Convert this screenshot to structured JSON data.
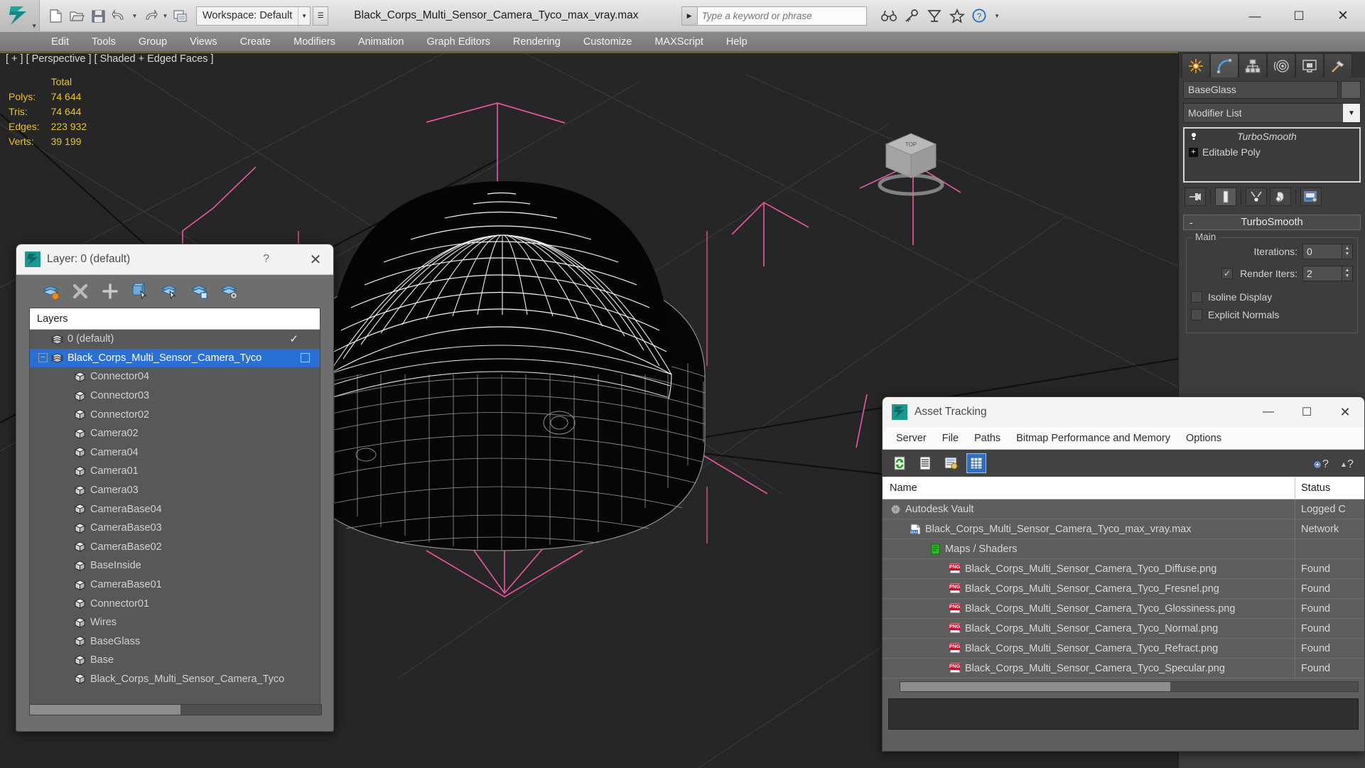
{
  "titlebar": {
    "workspace_label": "Workspace: Default",
    "file_title": "Black_Corps_Multi_Sensor_Camera_Tyco_max_vray.max",
    "search_placeholder": "Type a keyword or phrase",
    "quick_access": [
      {
        "name": "new-file-icon",
        "label": "New"
      },
      {
        "name": "open-file-icon",
        "label": "Open"
      },
      {
        "name": "save-file-icon",
        "label": "Save"
      },
      {
        "name": "undo-icon",
        "label": "Undo"
      },
      {
        "name": "redo-icon",
        "label": "Redo"
      },
      {
        "name": "project-folder-icon",
        "label": "Set Project Folder"
      }
    ],
    "help_icons": [
      {
        "name": "binoculars-icon",
        "label": "Search"
      },
      {
        "name": "key-icon",
        "label": "Keyboard Shortcuts"
      },
      {
        "name": "satellite-dish-icon",
        "label": "Communication Center"
      },
      {
        "name": "star-icon",
        "label": "Favorites"
      },
      {
        "name": "question-help-icon",
        "label": "Help"
      }
    ],
    "window_buttons": {
      "minimize": "—",
      "maximize": "☐",
      "close": "✕"
    }
  },
  "menubar": {
    "items": [
      "Edit",
      "Tools",
      "Group",
      "Views",
      "Create",
      "Modifiers",
      "Animation",
      "Graph Editors",
      "Rendering",
      "Customize",
      "MAXScript",
      "Help"
    ]
  },
  "viewport": {
    "label": "[ + ] [ Perspective ] [ Shaded + Edged Faces ]",
    "stats": {
      "column_header": "Total",
      "rows": [
        {
          "label": "Polys:",
          "value": "74 644"
        },
        {
          "label": "Tris:",
          "value": "74 644"
        },
        {
          "label": "Edges:",
          "value": "223 932"
        },
        {
          "label": "Verts:",
          "value": "39 199"
        }
      ]
    },
    "viewcube_label": "TOP"
  },
  "command_panel": {
    "tabs": [
      {
        "name": "create-tab",
        "label": "Create"
      },
      {
        "name": "modify-tab",
        "label": "Modify"
      },
      {
        "name": "hierarchy-tab",
        "label": "Hierarchy"
      },
      {
        "name": "motion-tab",
        "label": "Motion"
      },
      {
        "name": "display-tab",
        "label": "Display"
      },
      {
        "name": "utilities-tab",
        "label": "Utilities"
      }
    ],
    "active_tab_index": 1,
    "object_name": "BaseGlass",
    "modifier_list_label": "Modifier List",
    "modifier_stack": [
      {
        "label": "TurboSmooth",
        "italic": true
      },
      {
        "label": "Editable Poly",
        "italic": false
      }
    ],
    "stack_tools": [
      {
        "name": "pin-stack-icon"
      },
      {
        "name": "show-end-result-icon"
      },
      {
        "name": "make-unique-icon"
      },
      {
        "name": "remove-modifier-icon"
      },
      {
        "name": "configure-modifier-sets-icon"
      }
    ],
    "rollout": {
      "title": "TurboSmooth",
      "collapse_glyph": "-",
      "group_label": "Main",
      "iterations_label": "Iterations:",
      "iterations_value": "0",
      "render_iters_label": "Render Iters:",
      "render_iters_value": "2",
      "render_iters_checked": true,
      "isoline_label": "Isoline Display",
      "isoline_checked": false,
      "explicit_normals_label": "Explicit Normals",
      "explicit_normals_checked": false
    }
  },
  "layer_dialog": {
    "title": "Layer: 0 (default)",
    "help_glyph": "?",
    "close_glyph": "✕",
    "toolbar": [
      {
        "name": "new-layer-icon"
      },
      {
        "name": "delete-layer-icon"
      },
      {
        "name": "add-layer-icon"
      },
      {
        "name": "select-objects-in-layer-icon"
      },
      {
        "name": "select-highlighted-layer-icon"
      },
      {
        "name": "add-selection-to-layer-icon"
      },
      {
        "name": "layer-settings-icon"
      }
    ],
    "column_header": "Layers",
    "rows": [
      {
        "label": "0 (default)",
        "type": "layer",
        "indent": 0,
        "selected": false,
        "expander": null,
        "checked": true
      },
      {
        "label": "Black_Corps_Multi_Sensor_Camera_Tyco",
        "type": "layer",
        "indent": 0,
        "selected": true,
        "expander": "−",
        "checked": false,
        "box": true
      },
      {
        "label": "Connector04",
        "type": "object",
        "indent": 1,
        "selected": false
      },
      {
        "label": "Connector03",
        "type": "object",
        "indent": 1,
        "selected": false
      },
      {
        "label": "Connector02",
        "type": "object",
        "indent": 1,
        "selected": false
      },
      {
        "label": "Camera02",
        "type": "object",
        "indent": 1,
        "selected": false
      },
      {
        "label": "Camera04",
        "type": "object",
        "indent": 1,
        "selected": false
      },
      {
        "label": "Camera01",
        "type": "object",
        "indent": 1,
        "selected": false
      },
      {
        "label": "Camera03",
        "type": "object",
        "indent": 1,
        "selected": false
      },
      {
        "label": "CameraBase04",
        "type": "object",
        "indent": 1,
        "selected": false
      },
      {
        "label": "CameraBase03",
        "type": "object",
        "indent": 1,
        "selected": false
      },
      {
        "label": "CameraBase02",
        "type": "object",
        "indent": 1,
        "selected": false
      },
      {
        "label": "BaseInside",
        "type": "object",
        "indent": 1,
        "selected": false
      },
      {
        "label": "CameraBase01",
        "type": "object",
        "indent": 1,
        "selected": false
      },
      {
        "label": "Connector01",
        "type": "object",
        "indent": 1,
        "selected": false
      },
      {
        "label": "Wires",
        "type": "object",
        "indent": 1,
        "selected": false
      },
      {
        "label": "BaseGlass",
        "type": "object",
        "indent": 1,
        "selected": false
      },
      {
        "label": "Base",
        "type": "object",
        "indent": 1,
        "selected": false
      },
      {
        "label": "Black_Corps_Multi_Sensor_Camera_Tyco",
        "type": "object",
        "indent": 1,
        "selected": false
      }
    ]
  },
  "asset_tracking": {
    "title": "Asset Tracking",
    "window_buttons": {
      "minimize": "—",
      "maximize": "☐",
      "close": "✕"
    },
    "menu": [
      "Server",
      "File",
      "Paths",
      "Bitmap Performance and Memory",
      "Options"
    ],
    "toolbar": [
      {
        "name": "refresh-icon",
        "active": false
      },
      {
        "name": "list-view-icon",
        "active": false
      },
      {
        "name": "detail-view-icon",
        "active": false
      },
      {
        "name": "grid-view-icon",
        "active": true
      }
    ],
    "toolbar_right": [
      {
        "name": "help-add-icon"
      },
      {
        "name": "help-question-icon"
      }
    ],
    "columns": [
      "Name",
      "Status"
    ],
    "rows": [
      {
        "name": "Autodesk Vault",
        "status": "Logged C",
        "indent": 0,
        "icon": "vault-icon"
      },
      {
        "name": "Black_Corps_Multi_Sensor_Camera_Tyco_max_vray.max",
        "status": "Network",
        "indent": 1,
        "icon": "max-file-icon"
      },
      {
        "name": "Maps / Shaders",
        "status": "",
        "indent": 2,
        "icon": "maps-shaders-icon"
      },
      {
        "name": "Black_Corps_Multi_Sensor_Camera_Tyco_Diffuse.png",
        "status": "Found",
        "indent": 3,
        "icon": "png-icon"
      },
      {
        "name": "Black_Corps_Multi_Sensor_Camera_Tyco_Fresnel.png",
        "status": "Found",
        "indent": 3,
        "icon": "png-icon"
      },
      {
        "name": "Black_Corps_Multi_Sensor_Camera_Tyco_Glossiness.png",
        "status": "Found",
        "indent": 3,
        "icon": "png-icon"
      },
      {
        "name": "Black_Corps_Multi_Sensor_Camera_Tyco_Normal.png",
        "status": "Found",
        "indent": 3,
        "icon": "png-icon"
      },
      {
        "name": "Black_Corps_Multi_Sensor_Camera_Tyco_Refract.png",
        "status": "Found",
        "indent": 3,
        "icon": "png-icon"
      },
      {
        "name": "Black_Corps_Multi_Sensor_Camera_Tyco_Specular.png",
        "status": "Found",
        "indent": 3,
        "icon": "png-icon"
      }
    ]
  },
  "colors": {
    "accent_selection": "#2a6fd4",
    "stats_text": "#e8c52a",
    "viewport_bg": "#262626",
    "grid_pink": "#e3569b",
    "panel_bg": "#3d3d3d"
  }
}
